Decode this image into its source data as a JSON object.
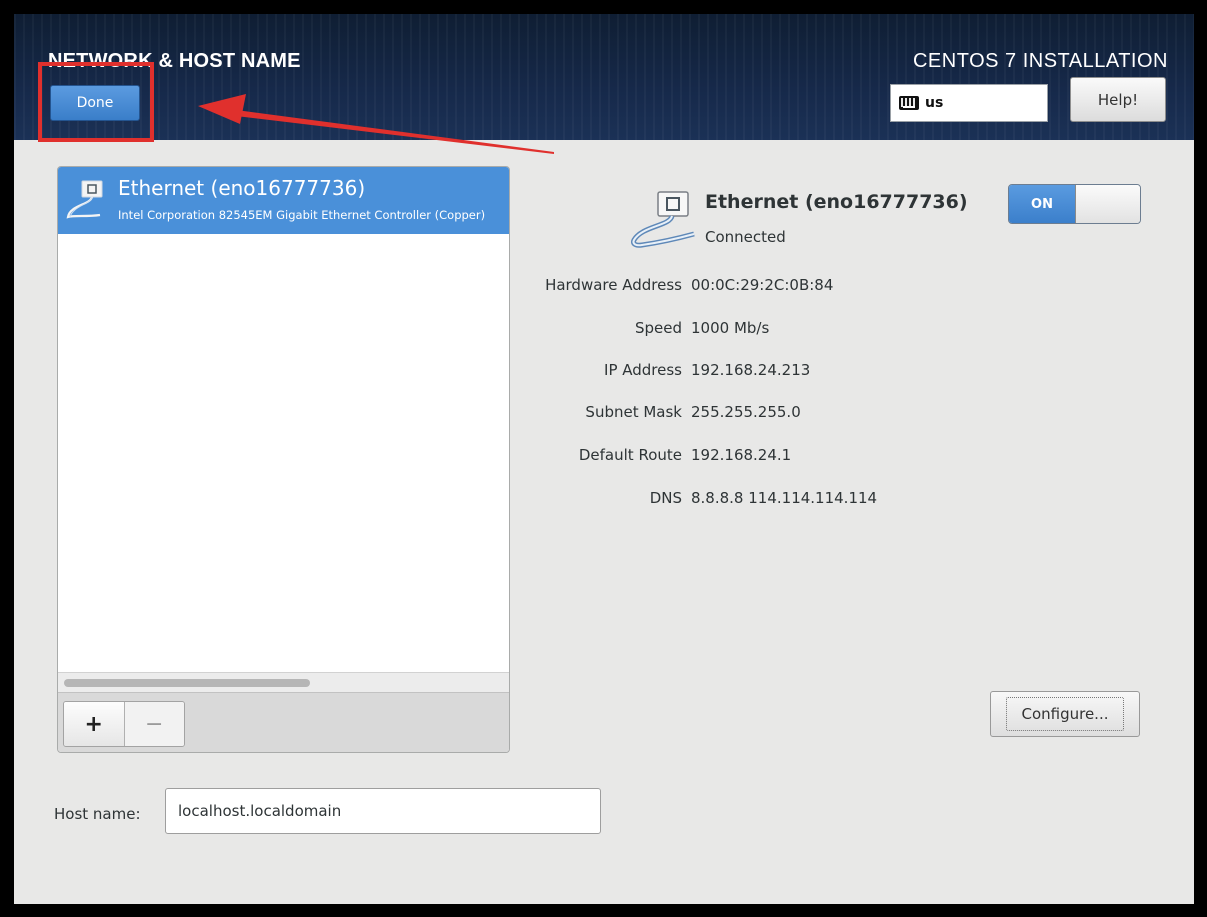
{
  "header": {
    "spoke_title": "NETWORK & HOST NAME",
    "install_title": "CENTOS 7 INSTALLATION",
    "done_label": "Done",
    "help_label": "Help!",
    "keyboard_layout": "us"
  },
  "devices": [
    {
      "name": "Ethernet (eno16777736)",
      "description": "Intel Corporation 82545EM Gigabit Ethernet Controller (Copper)",
      "selected": true
    }
  ],
  "toolbar": {
    "add_label": "+",
    "remove_label": "−"
  },
  "detail": {
    "name": "Ethernet (eno16777736)",
    "status": "Connected",
    "toggle_label": "ON",
    "toggle_on": true,
    "rows": [
      {
        "label": "Hardware Address",
        "value": "00:0C:29:2C:0B:84"
      },
      {
        "label": "Speed",
        "value": "1000 Mb/s"
      },
      {
        "label": "IP Address",
        "value": "192.168.24.213"
      },
      {
        "label": "Subnet Mask",
        "value": "255.255.255.0"
      },
      {
        "label": "Default Route",
        "value": "192.168.24.1"
      },
      {
        "label": "DNS",
        "value": "8.8.8.8 114.114.114.114"
      }
    ],
    "configure_label": "Configure..."
  },
  "hostname": {
    "label": "Host name:",
    "value": "localhost.localdomain"
  },
  "colors": {
    "accent": "#4a90d9",
    "header_bg": "#16294a",
    "annotation": "#e0302d"
  }
}
